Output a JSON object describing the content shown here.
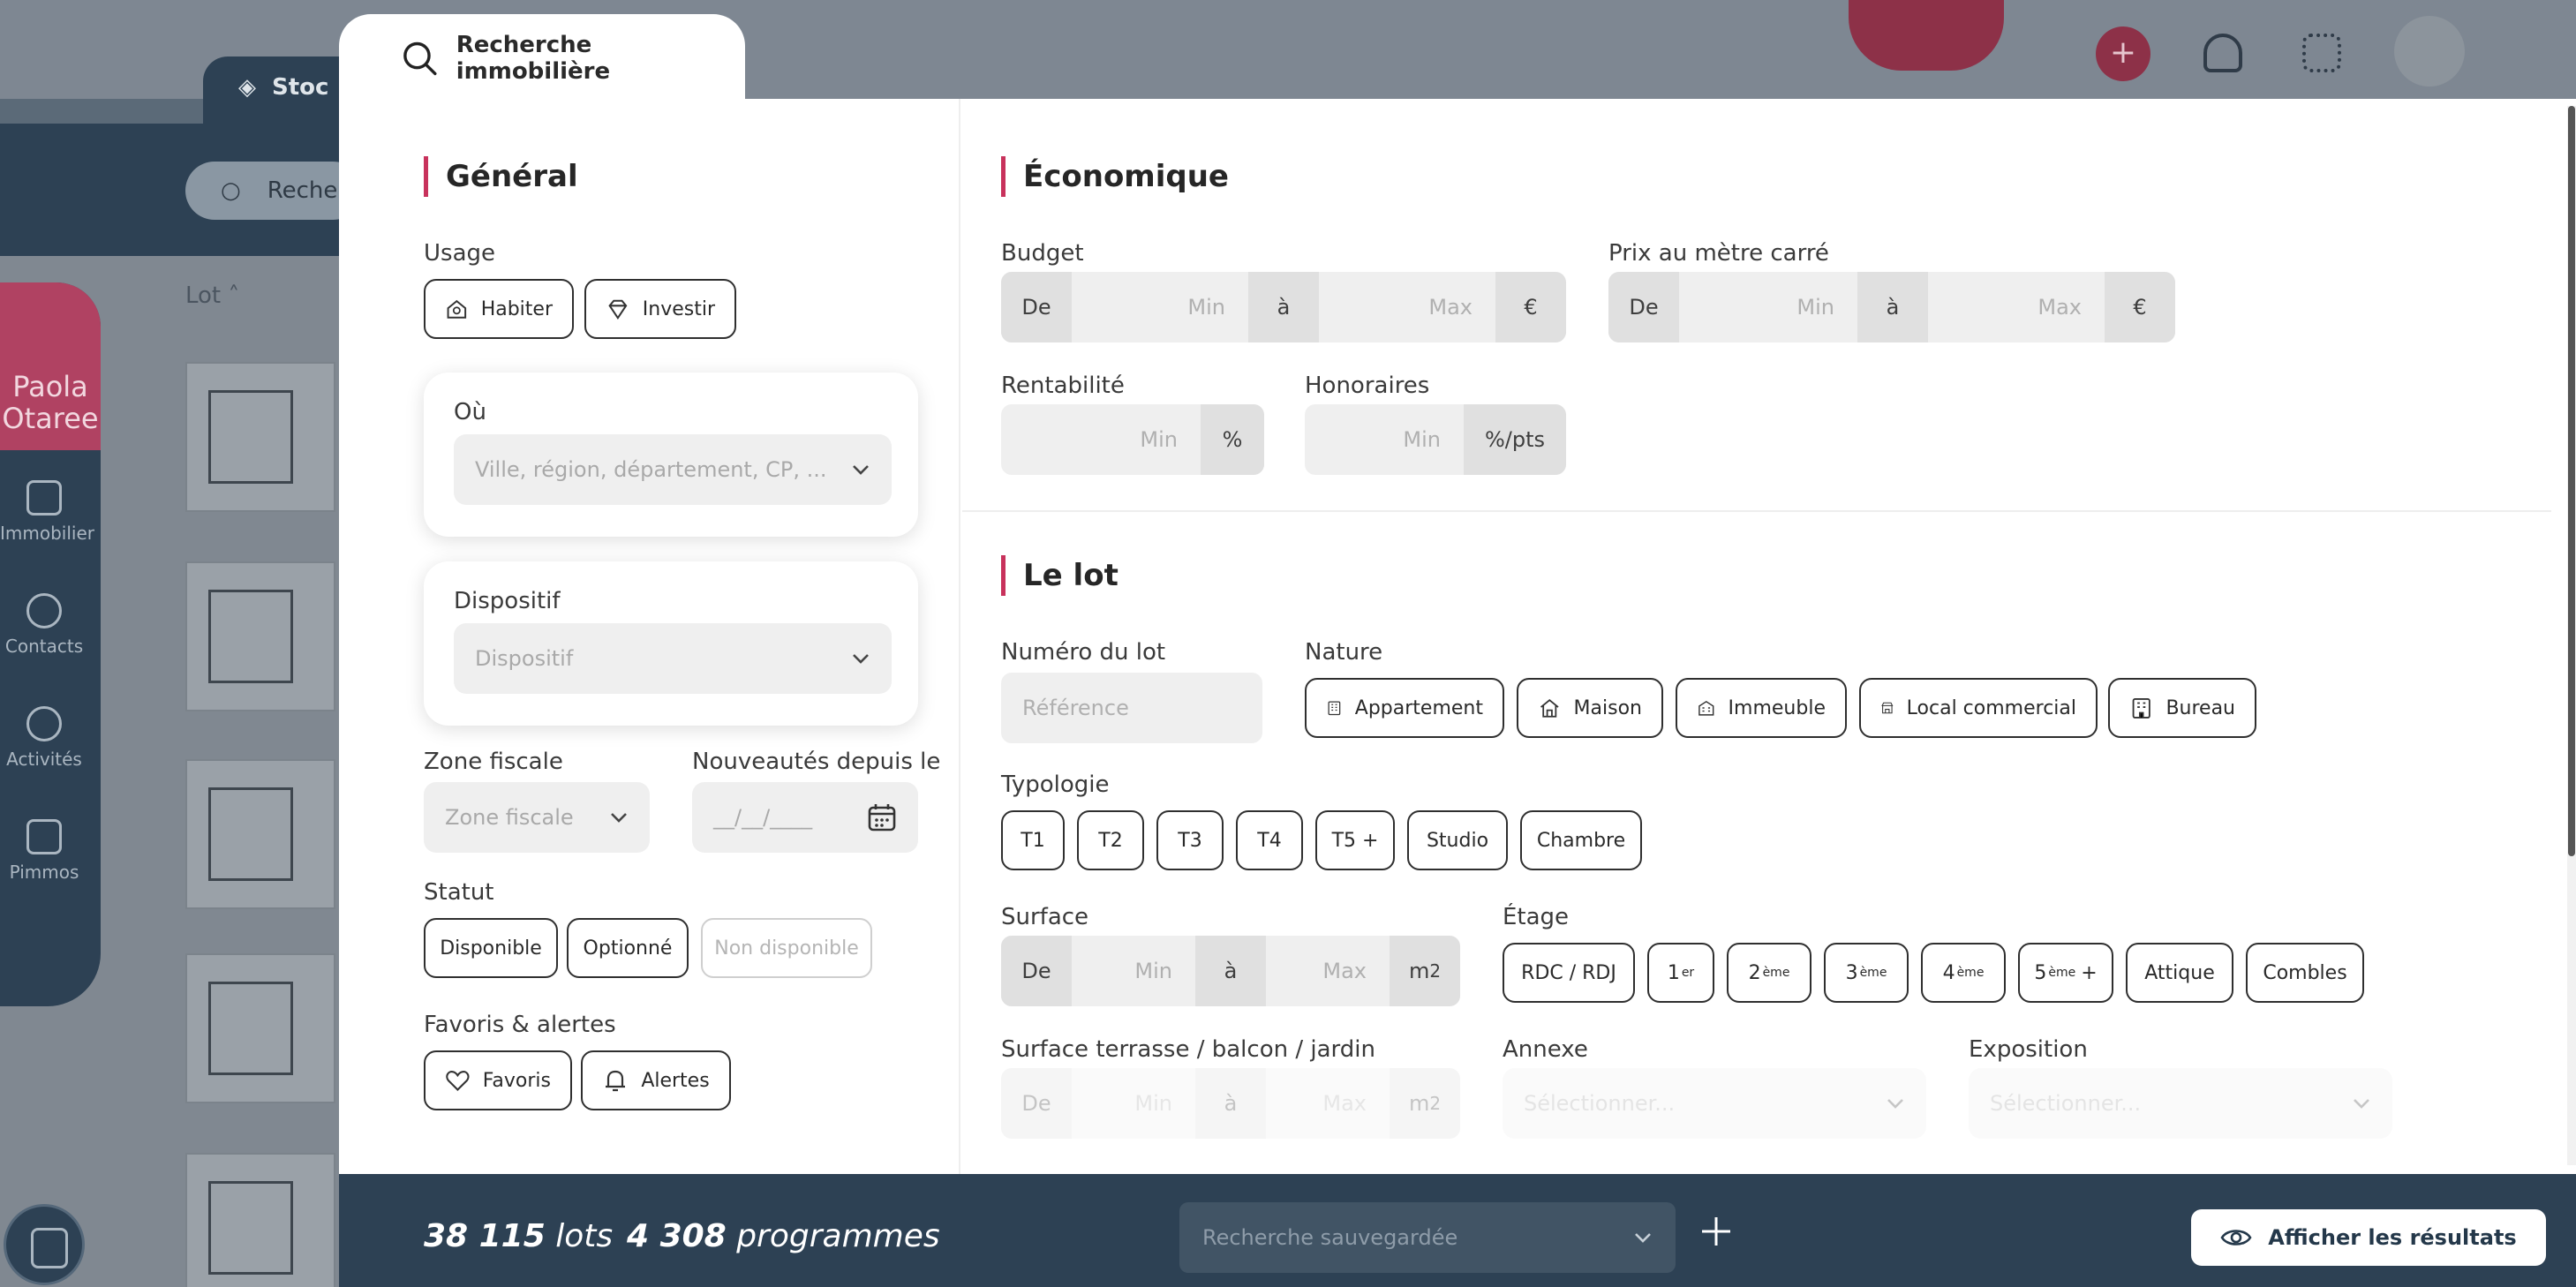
{
  "background": {
    "tab_label": "Stoc",
    "search_label": "Reche",
    "lot_label": "Lot",
    "user_name": "Paola Otaree",
    "sidebar": [
      "Immobilier",
      "Contacts",
      "Activités",
      "Pimmos"
    ]
  },
  "modal": {
    "title": "Recherche immobilière",
    "general": {
      "title": "Général",
      "usage_label": "Usage",
      "usage_options": [
        "Habiter",
        "Investir"
      ],
      "ou_label": "Où",
      "ou_placeholder": "Ville, région, département, CP, ...",
      "dispositif_label": "Dispositif",
      "dispositif_placeholder": "Dispositif",
      "zone_label": "Zone fiscale",
      "zone_placeholder": "Zone fiscale",
      "nouveautes_label": "Nouveautés depuis le",
      "date_placeholder": "__/__/____",
      "statut_label": "Statut",
      "statut_options": [
        "Disponible",
        "Optionné",
        "Non disponible"
      ],
      "favoris_label": "Favoris & alertes",
      "favoris_options": [
        "Favoris",
        "Alertes"
      ]
    },
    "economique": {
      "title": "Économique",
      "budget_label": "Budget",
      "prix_label": "Prix au mètre carré",
      "rentabilite_label": "Rentabilité",
      "honoraires_label": "Honoraires",
      "de": "De",
      "a": "à",
      "min": "Min",
      "max": "Max",
      "euro": "€",
      "percent": "%",
      "pct_pts": "%/pts"
    },
    "lot": {
      "title": "Le lot",
      "numero_label": "Numéro du lot",
      "numero_placeholder": "Référence",
      "nature_label": "Nature",
      "nature_options": [
        "Appartement",
        "Maison",
        "Immeuble",
        "Local commercial",
        "Bureau"
      ],
      "typologie_label": "Typologie",
      "typologie_options": [
        "T1",
        "T2",
        "T3",
        "T4",
        "T5 +",
        "Studio",
        "Chambre"
      ],
      "surface_label": "Surface",
      "unit": "m",
      "unit_exp": "2",
      "etage_label": "Étage",
      "etage_rdc": "RDC / RDJ",
      "etage_1": "1",
      "etage_1_sup": "er",
      "etage_n": [
        "2",
        "3",
        "4"
      ],
      "etage_n_sup": "ème",
      "etage_5": "5",
      "etage_5_suffix": "+",
      "etage_attique": "Attique",
      "etage_combles": "Combles",
      "terrasse_label": "Surface terrasse / balcon / jardin",
      "annexe_label": "Annexe",
      "exposition_label": "Exposition",
      "select_placeholder": "Sélectionner..."
    }
  },
  "footer": {
    "lots_number": "38 115",
    "lots_word": "lots",
    "programmes_number": "4 308",
    "programmes_word": "programmes",
    "saved_placeholder": "Recherche sauvegardée",
    "show_results": "Afficher les résultats"
  },
  "colors": {
    "accent": "#c8325c",
    "navy": "#2d4154"
  }
}
